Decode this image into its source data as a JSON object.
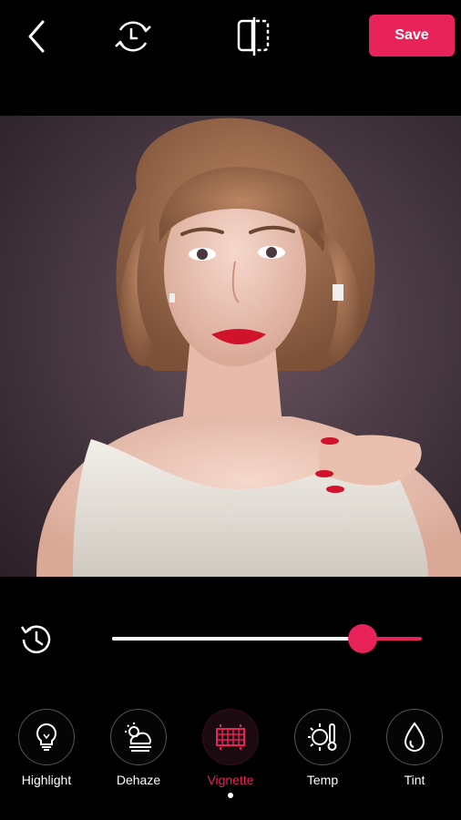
{
  "toolbar": {
    "save_label": "Save",
    "back_icon": "back-arrow-icon",
    "history_icon": "history-icon",
    "compare_icon": "compare-icon"
  },
  "adjustment": {
    "value_fraction": 0.81,
    "reset_icon": "reset-history-icon"
  },
  "tools": [
    {
      "label": "Highlight",
      "icon": "lightbulb-icon",
      "active": false
    },
    {
      "label": "Dehaze",
      "icon": "cloud-sun-icon",
      "active": false
    },
    {
      "label": "Vignette",
      "icon": "vignette-icon",
      "active": true
    },
    {
      "label": "Temp",
      "icon": "thermometer-sun-icon",
      "active": false
    },
    {
      "label": "Tint",
      "icon": "droplet-icon",
      "active": false
    }
  ],
  "colors": {
    "accent": "#e8235a",
    "background": "#000000"
  }
}
